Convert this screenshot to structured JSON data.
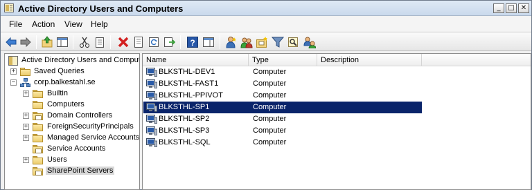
{
  "window": {
    "title": "Active Directory Users and Computers",
    "minimize_glyph": "_",
    "maximize_glyph": "□",
    "close_glyph": "✕"
  },
  "menu": [
    "File",
    "Action",
    "View",
    "Help"
  ],
  "toolbar_icons": [
    "back-arrow-icon",
    "forward-arrow-icon",
    "up-folder-icon",
    "show-hide-console-tree-icon",
    "cut-icon",
    "copy-icon",
    "delete-icon",
    "properties-icon",
    "refresh-icon",
    "export-list-icon",
    "help-icon",
    "action-pane-icon",
    "new-user-icon",
    "new-group-icon",
    "new-ou-icon",
    "filter-icon",
    "find-icon",
    "add-to-group-icon"
  ],
  "tree": {
    "root": "Active Directory Users and Comput",
    "saved_queries": "Saved Queries",
    "domain": "corp.balkestahl.se",
    "children": [
      {
        "label": "Builtin",
        "expandable": true,
        "icon": "folder-icon"
      },
      {
        "label": "Computers",
        "expandable": false,
        "icon": "folder-icon"
      },
      {
        "label": "Domain Controllers",
        "expandable": true,
        "icon": "ou-folder-icon"
      },
      {
        "label": "ForeignSecurityPrincipals",
        "expandable": true,
        "icon": "folder-icon"
      },
      {
        "label": "Managed Service Accounts",
        "expandable": true,
        "icon": "folder-icon"
      },
      {
        "label": "Service Accounts",
        "expandable": false,
        "icon": "ou-folder-icon"
      },
      {
        "label": "Users",
        "expandable": true,
        "icon": "folder-icon"
      },
      {
        "label": "SharePoint Servers",
        "expandable": false,
        "icon": "ou-folder-icon",
        "selected": true
      }
    ]
  },
  "list": {
    "columns": {
      "name": "Name",
      "type": "Type",
      "description": "Description"
    },
    "rows": [
      {
        "name": "BLKSTHL-DEV1",
        "type": "Computer",
        "selected": false
      },
      {
        "name": "BLKSTHL-FAST1",
        "type": "Computer",
        "selected": false
      },
      {
        "name": "BLKSTHL-PPIVOT",
        "type": "Computer",
        "selected": false
      },
      {
        "name": "BLKSTHL-SP1",
        "type": "Computer",
        "selected": true
      },
      {
        "name": "BLKSTHL-SP2",
        "type": "Computer",
        "selected": false
      },
      {
        "name": "BLKSTHL-SP3",
        "type": "Computer",
        "selected": false
      },
      {
        "name": "BLKSTHL-SQL",
        "type": "Computer",
        "selected": false
      }
    ]
  },
  "colors": {
    "selection": "#0a246a",
    "tree_selection": "#d9d9d9"
  }
}
